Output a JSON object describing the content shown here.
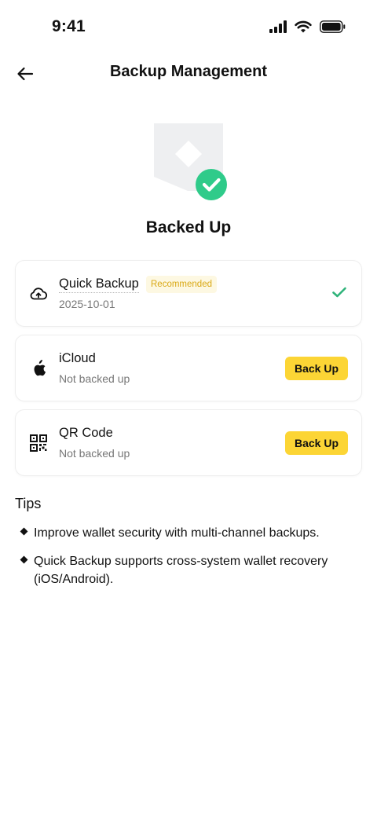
{
  "status_bar": {
    "time": "9:41",
    "icons": [
      "cellular-signal-icon",
      "wifi-icon",
      "battery-icon"
    ]
  },
  "header": {
    "title": "Backup Management",
    "back_icon": "arrow-left-icon"
  },
  "hero": {
    "status": "Backed Up",
    "icon": "shield-check-icon",
    "accent_color": "#2fcb8a"
  },
  "backup_options": [
    {
      "title": "Quick Backup",
      "badge": "Recommended",
      "subtitle": "2025-10-01",
      "icon": "cloud-upload-icon",
      "state": "done"
    },
    {
      "title": "iCloud",
      "subtitle": "Not backed up",
      "icon": "apple-icon",
      "action_label": "Back Up"
    },
    {
      "title": "QR Code",
      "subtitle": "Not backed up",
      "icon": "qr-code-icon",
      "action_label": "Back Up"
    }
  ],
  "tips": {
    "title": "Tips",
    "items": [
      "Improve wallet security with multi-channel backups.",
      "Quick Backup supports cross-system wallet recovery (iOS/Android)."
    ]
  },
  "colors": {
    "brand_yellow": "#fcd535",
    "success_green": "#2fcb8a",
    "badge_text": "#d9a814"
  }
}
